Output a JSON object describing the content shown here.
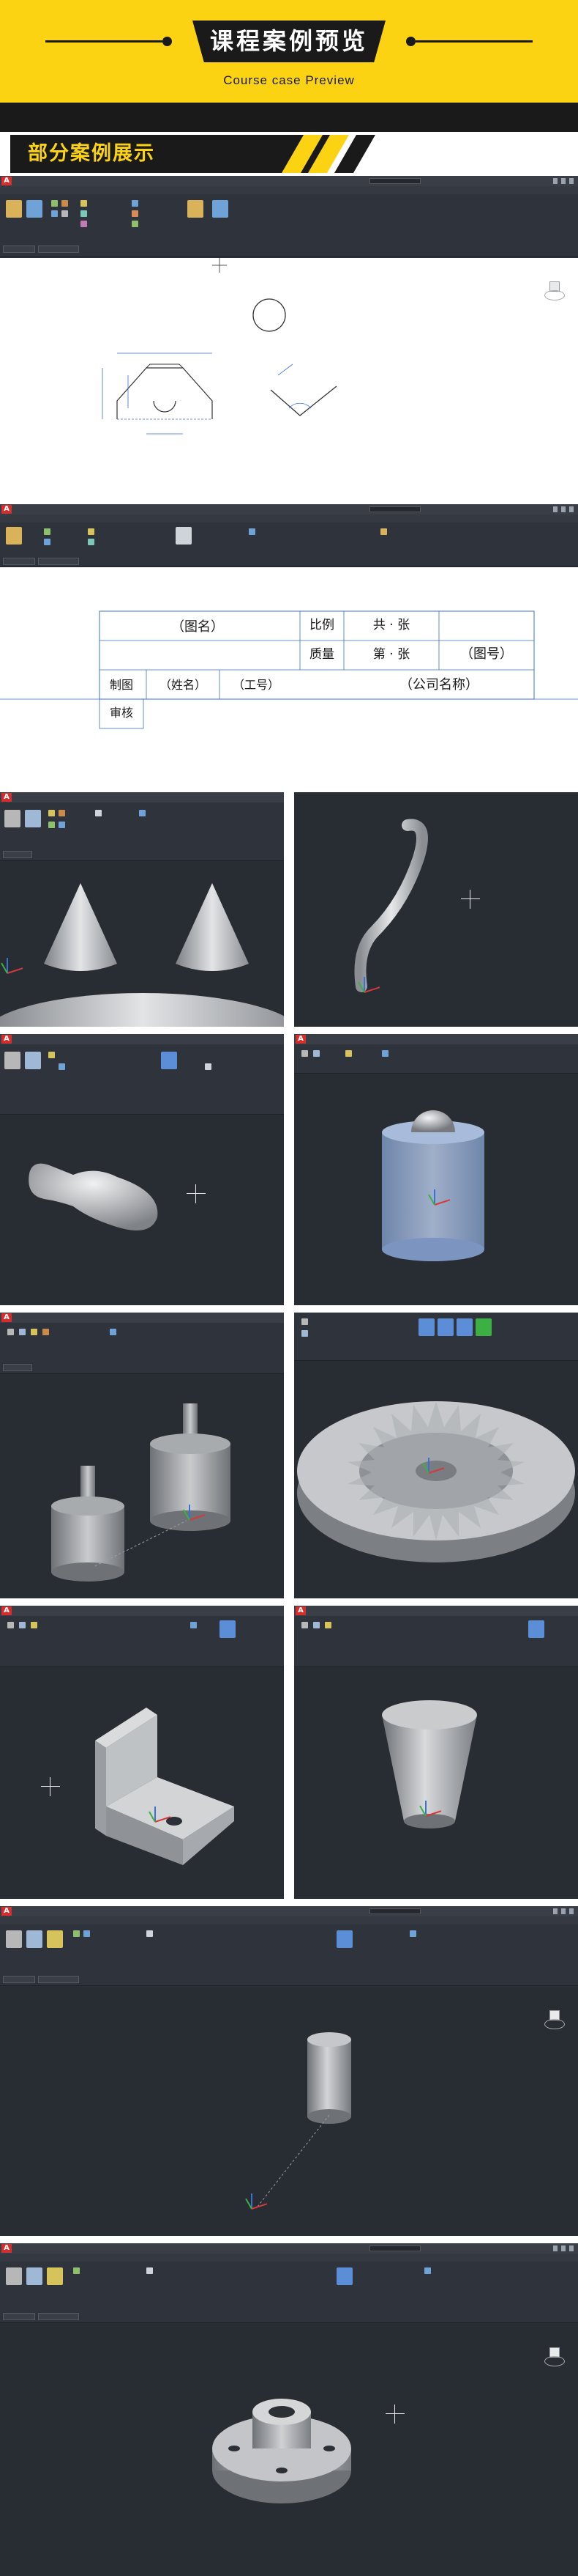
{
  "header": {
    "title": "课程案例预览",
    "subtitle": "Course case Preview"
  },
  "section": {
    "label": "部分案例展示"
  },
  "colors": {
    "brand_yellow": "#fbd312",
    "dark": "#1a1a1a",
    "cad_bg": "#282c33",
    "cad_ribbon": "#2f343c",
    "autocad_red": "#d62d2d"
  },
  "drawing2": {
    "cells": {
      "tuming": "（图名）",
      "bili": "比例",
      "gong_zhang": "共 · 张",
      "tuhao": "（图号）",
      "zhiliang": "质量",
      "di_zhang": "第 · 张",
      "zhitu": "制图",
      "xingming": "（姓名）",
      "gonghao": "（工号）",
      "gongsi": "（公司名称）",
      "shenhe": "审核"
    }
  },
  "icons": {
    "app": "autocad-logo-icon",
    "ucs": "ucs-axis-icon",
    "viewcube": "viewcube-icon",
    "cursor": "crosshair-cursor-icon"
  }
}
